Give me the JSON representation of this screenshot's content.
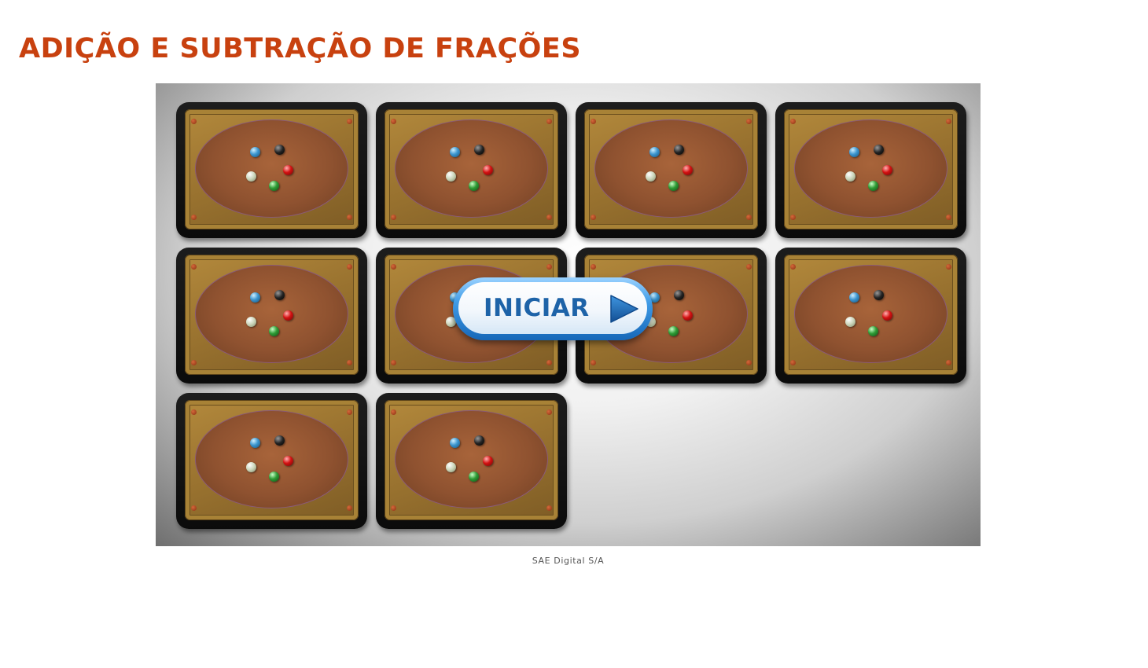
{
  "page": {
    "title": "ADIÇÃO E SUBTRAÇÃO DE FRAÇÕES",
    "footer": "SAE Digital S/A"
  },
  "game": {
    "start_label": "INICIAR",
    "start_icon": "play-triangle-icon",
    "card_count": 10,
    "card_back_icon": "bead-cluster-icon",
    "bead_colors": [
      "blue",
      "black",
      "red",
      "white",
      "green"
    ]
  },
  "colors": {
    "title": "#c8410f",
    "button_text": "#1d63a8",
    "card_plate": "#9b7430",
    "card_oval": "#8f5230"
  }
}
